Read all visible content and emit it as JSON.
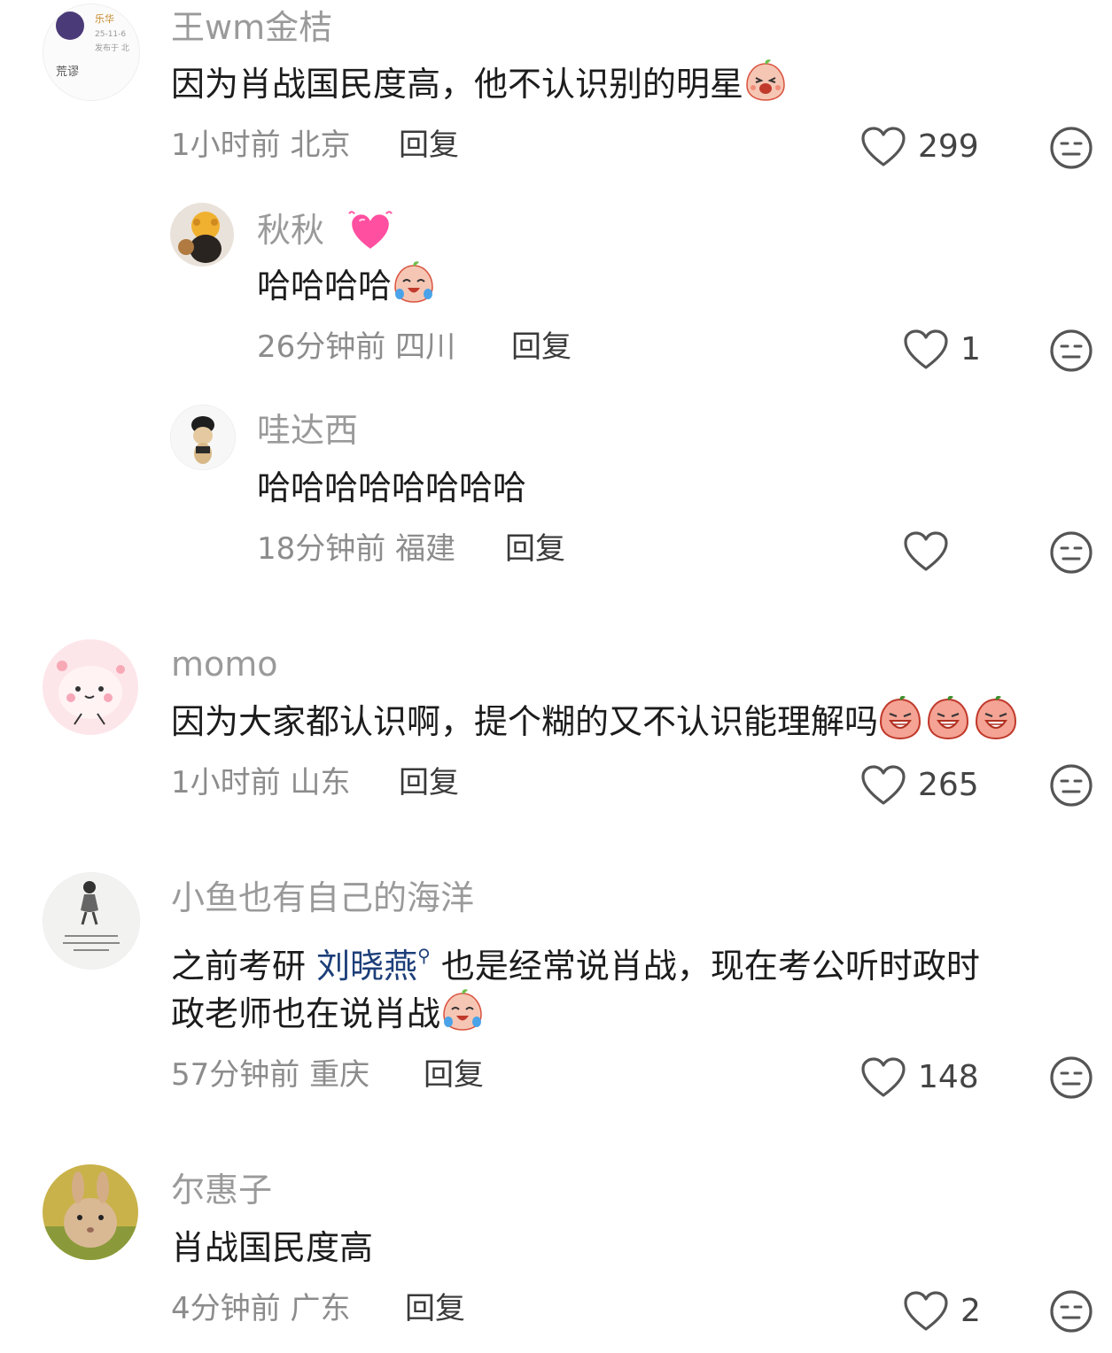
{
  "comments": [
    {
      "avatar_caption": "荒谬",
      "avatar_line1": "乐华",
      "avatar_line2": "25-11-6",
      "avatar_line3": "发布于 北",
      "name": "王wm金桔",
      "text": "因为肖战国民度高，他不认识别的明星",
      "time": "1小时前",
      "location": "北京",
      "reply": "回复",
      "likes": "299"
    },
    {
      "name": "秋秋",
      "text": "哈哈哈哈",
      "time": "26分钟前",
      "location": "四川",
      "reply": "回复",
      "likes": "1"
    },
    {
      "name": "哇达西",
      "text": "哈哈哈哈哈哈哈哈",
      "time": "18分钟前",
      "location": "福建",
      "reply": "回复",
      "likes": ""
    },
    {
      "name": "momo",
      "text": "因为大家都认识啊，提个糊的又不认识能理解吗",
      "time": "1小时前",
      "location": "山东",
      "reply": "回复",
      "likes": "265"
    },
    {
      "name": "小鱼也有自己的海洋",
      "text_before": "之前考研 ",
      "mention": "刘晓燕",
      "text_after": " 也是经常说肖战，现在考公听时政时",
      "text_line2": "政老师也在说肖战",
      "time": "57分钟前",
      "location": "重庆",
      "reply": "回复",
      "likes": "148"
    },
    {
      "name": "尔惠子",
      "text": "肖战国民度高",
      "time": "4分钟前",
      "location": "广东",
      "reply": "回复",
      "likes": "2"
    }
  ],
  "icons": {
    "like": "heart-outline-icon",
    "dislike": "neutral-face-icon",
    "emoji_laugh": "peach-laughing-emoji",
    "emoji_cry": "peach-crying-emoji",
    "emoji_scream": "peach-screaming-emoji",
    "emoji_heart": "pink-heart-emoji"
  }
}
